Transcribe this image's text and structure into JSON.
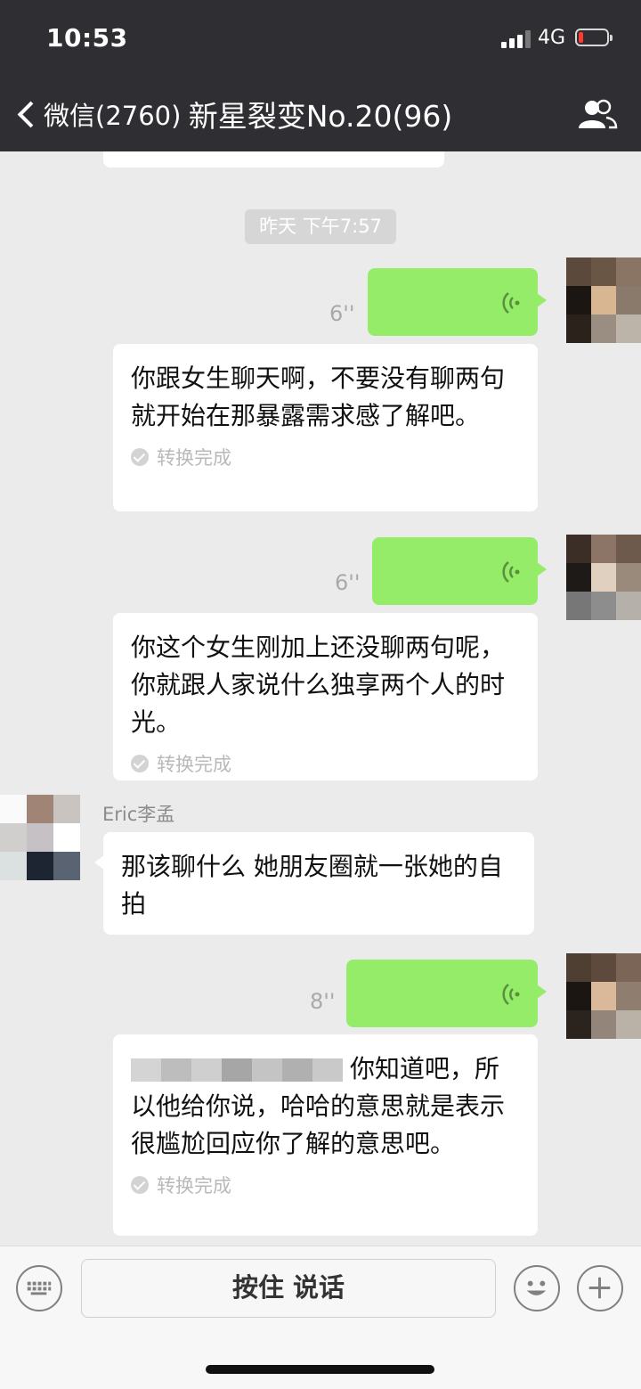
{
  "status_bar": {
    "time": "10:53",
    "network": "4G"
  },
  "nav": {
    "back_label": "微信(2760)",
    "title": "新星裂变No.20(96)"
  },
  "chat": {
    "timestamp": "昨天 下午7:57",
    "messages": [
      {
        "type": "voice",
        "duration": "6''",
        "transcript": "你跟女生聊天啊，不要没有聊两句就开始在那暴露需求感了解吧。",
        "status": "转换完成"
      },
      {
        "type": "voice",
        "duration": "6''",
        "transcript": "你这个女生刚加上还没聊两句呢，你就跟人家说什么独享两个人的时光。",
        "status": "转换完成"
      },
      {
        "type": "text",
        "sender": "Eric李孟",
        "text": "那该聊什么 她朋友圈就一张她的自拍"
      },
      {
        "type": "voice",
        "duration": "8''",
        "transcript_suffix": "你知道吧，所以他给你说，哈哈的意思就是表示很尴尬回应你了解的意思吧。",
        "status": "转换完成"
      }
    ]
  },
  "input_bar": {
    "talk_label": "按住 说话"
  },
  "colors": {
    "voice_bubble": "#95ec69",
    "header_bg": "#2e2e33",
    "chat_bg": "#ebebeb"
  }
}
